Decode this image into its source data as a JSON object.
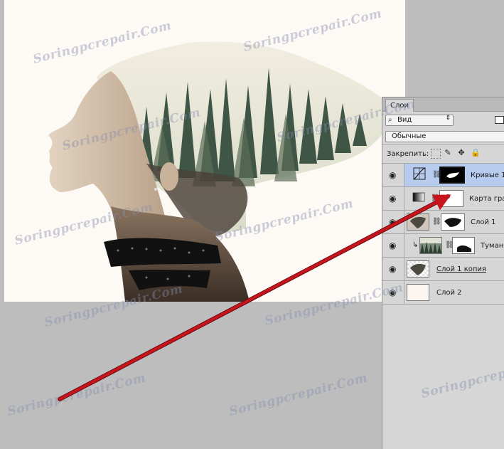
{
  "watermark": "Soringpcrepair.Com",
  "layers_panel": {
    "tab": "Слои",
    "kind_filter": "Вид",
    "blend_mode": "Обычные",
    "lock_label": "Закрепить:",
    "layers": [
      {
        "name": "Кривые 1",
        "selected": true
      },
      {
        "name": "Карта град"
      },
      {
        "name": "Слой 1"
      },
      {
        "name": "Туман-"
      },
      {
        "name": "Слой 1 копия"
      },
      {
        "name": "Слой 2"
      }
    ]
  },
  "colors": {
    "selection": "#b7cbee",
    "arrow": "#c8141c",
    "canvas_bg": "#fdf9f5"
  }
}
